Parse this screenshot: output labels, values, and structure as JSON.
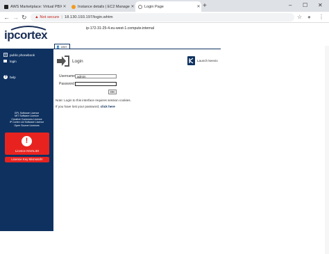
{
  "browser": {
    "tabs": [
      {
        "label": "AWS Marketplace: Virtual PBX",
        "active": false,
        "icon": "amazon-icon"
      },
      {
        "label": "Instance details | EC2 Managem",
        "active": false,
        "icon": "aws-icon"
      },
      {
        "label": "Login Page",
        "active": true,
        "icon": "globe-icon"
      }
    ],
    "new_tab": "+",
    "window_controls": {
      "minimize": "–",
      "maximize": "☐",
      "close": "✕"
    },
    "nav": {
      "back": "←",
      "forward": "→",
      "reload": "↻"
    },
    "security_warning": "Not secure",
    "url": "18.130.193.197/login.whtm",
    "star": "☆",
    "profile": "●",
    "menu": "⋮"
  },
  "header": {
    "logo_text": "ipcortex",
    "hostname": "ip-172-31-25-4.eu-west-1.compute.internal"
  },
  "sidebar": {
    "items": [
      {
        "label": "public phonebook",
        "icon": "phonebook-icon"
      },
      {
        "label": "login",
        "icon": "key-icon"
      },
      {
        "label": "help",
        "icon": "help-icon"
      }
    ],
    "legal": [
      "GPL Software Licence",
      "MIT Software Licence",
      "Creative Commons Licence",
      "IP Cortex Ltd Software Licence",
      "Open Source Licences"
    ],
    "licence_alert": {
      "symbol": "!",
      "text": "Licence INVALID!"
    },
    "licence_button": "Licence Key Mismatch!"
  },
  "content": {
    "tab_label": "user",
    "login_title": "Login",
    "launch_label": "Launch keevio",
    "form": {
      "username_label": "Username",
      "username_value": "admin",
      "password_label": "Password",
      "ok_label": "OK"
    },
    "note": "Note: Login to this interface requires session cookies.",
    "lost_prefix": "If you have lost your password,",
    "lost_link": "click here"
  },
  "colors": {
    "sidebar": "#0e3160",
    "alert": "#e8231f",
    "warning": "#c5221f"
  }
}
